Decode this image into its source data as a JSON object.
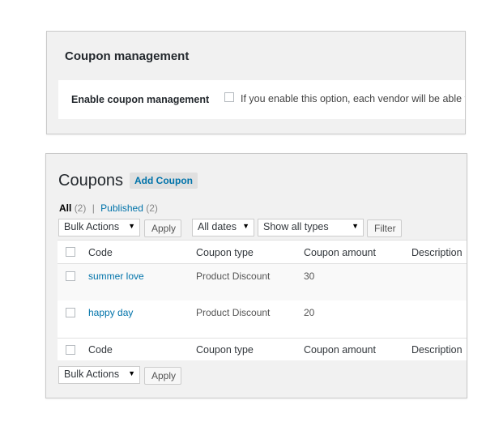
{
  "coupon_management": {
    "title": "Coupon management",
    "enable_label": "Enable coupon management",
    "enable_description": "If you enable this option, each vendor will be able t"
  },
  "coupons": {
    "title": "Coupons",
    "add_button": "Add Coupon",
    "filters": {
      "all_label": "All",
      "all_count": "(2)",
      "separator": "|",
      "published_label": "Published",
      "published_count": "(2)"
    },
    "bulk_actions": "Bulk Actions",
    "apply": "Apply",
    "dates": "All dates",
    "types": "Show all types",
    "filter": "Filter",
    "columns": [
      "Code",
      "Coupon type",
      "Coupon amount",
      "Description"
    ],
    "rows": [
      {
        "code": "summer love",
        "type": "Product Discount",
        "amount": "30"
      },
      {
        "code": "happy day",
        "type": "Product Discount",
        "amount": "20"
      }
    ],
    "bulk_actions_bottom": "Bulk Actions",
    "apply_bottom": "Apply"
  },
  "colors": {
    "link": "#0073aa",
    "panel_bg": "#f1f1f1"
  }
}
